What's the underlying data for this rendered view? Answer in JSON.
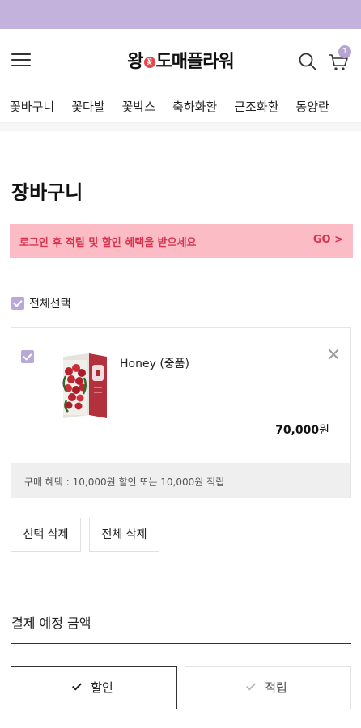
{
  "header": {
    "logo_pre": "왕",
    "logo_badge": "꽃",
    "logo_post": "도매플라워",
    "cart_count": "1"
  },
  "categories": [
    "꽃바구니",
    "꽃다발",
    "꽃박스",
    "축하화환",
    "근조화환",
    "동양란"
  ],
  "page_title": "장바구니",
  "login_banner": {
    "text": "로그인 후 적립 및 할인 혜택을 받으세요",
    "go": "GO >"
  },
  "select_all_label": "전체선택",
  "cart_items": [
    {
      "name": "Honey (중품)",
      "price": "70,000",
      "currency": "원",
      "checked": true,
      "benefit": "구매 혜택 : 10,000원 할인 또는 10,000원 적립"
    }
  ],
  "actions": {
    "delete_selected": "선택 삭제",
    "delete_all": "전체 삭제"
  },
  "payment": {
    "title": "결제 예정 금액",
    "discount_label": "할인",
    "points_label": "적립",
    "selected": "할인"
  },
  "colors": {
    "statusbar": "#c3b2dc",
    "checkbox": "#b8a9d8",
    "banner_bg": "#fbbcc6",
    "banner_text": "#d9334e"
  }
}
